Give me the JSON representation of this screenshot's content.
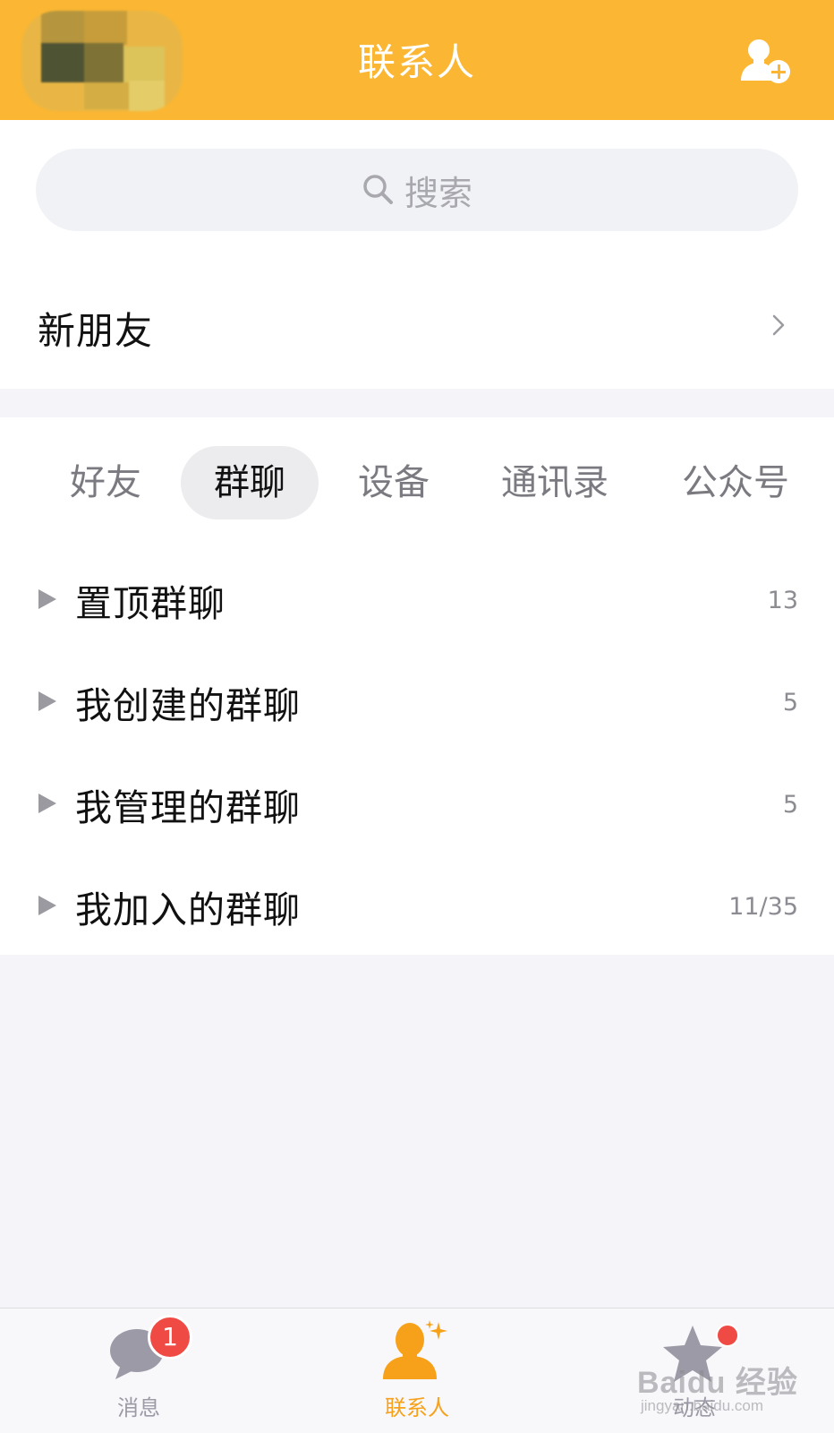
{
  "header": {
    "title": "联系人",
    "avatar_icon": "pixelated-avatar",
    "add_icon": "add-contact-icon",
    "bg_color": "#fbb733"
  },
  "search": {
    "placeholder": "搜索",
    "icon": "search-icon"
  },
  "new_friends": {
    "label": "新朋友",
    "icon": "chevron-right-icon"
  },
  "tabs": [
    {
      "label": "好友",
      "active": false
    },
    {
      "label": "群聊",
      "active": true
    },
    {
      "label": "设备",
      "active": false
    },
    {
      "label": "通讯录",
      "active": false
    },
    {
      "label": "公众号",
      "active": false
    }
  ],
  "groups": [
    {
      "label": "置顶群聊",
      "count": "13"
    },
    {
      "label": "我创建的群聊",
      "count": "5"
    },
    {
      "label": "我管理的群聊",
      "count": "5"
    },
    {
      "label": "我加入的群聊",
      "count": "11/35"
    }
  ],
  "bottom_nav": [
    {
      "label": "消息",
      "icon": "chat-bubble-icon",
      "badge": "1",
      "active": false
    },
    {
      "label": "联系人",
      "icon": "contact-person-icon",
      "active": true
    },
    {
      "label": "动态",
      "icon": "star-icon",
      "dot": true,
      "active": false
    }
  ],
  "watermark": {
    "main": "Baidu 经验",
    "sub": "jingyan.baidu.com"
  },
  "colors": {
    "accent": "#fbb733",
    "active_nav": "#f7a11a",
    "inactive_nav": "#9c9aa6",
    "badge": "#f04a45"
  }
}
